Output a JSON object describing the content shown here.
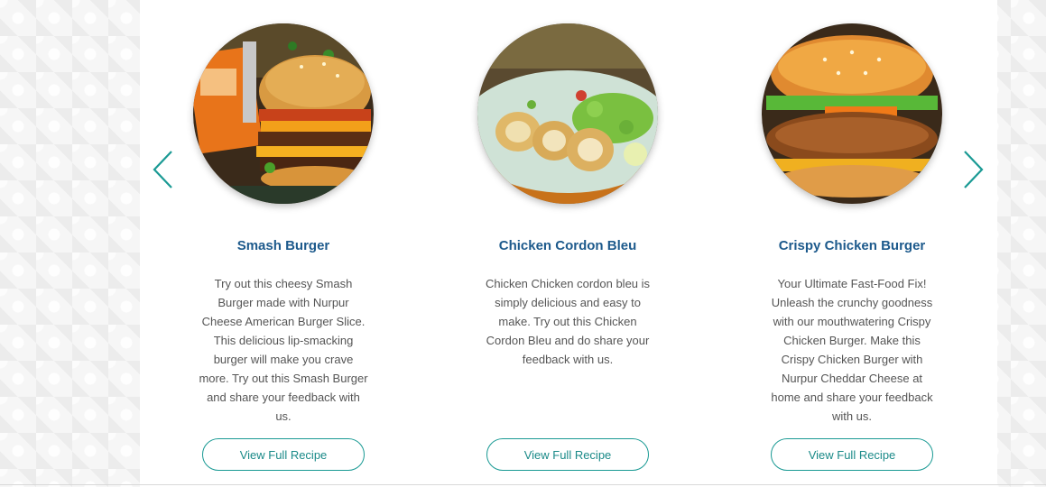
{
  "carousel": {
    "prev_icon": "chevron-left-icon",
    "next_icon": "chevron-right-icon",
    "accent_color": "#1a9a94",
    "title_color": "#1d5a8c",
    "cards": [
      {
        "title": "Smash Burger",
        "description": "Try out this cheesy Smash Burger made with Nurpur Cheese American Burger Slice. This delicious lip-smacking burger will make you crave more. Try out this Smash Burger and share your feedback with us.",
        "button_label": "View Full Recipe",
        "image": "smash-burger-photo"
      },
      {
        "title": "Chicken Cordon Bleu",
        "description": "Chicken Chicken cordon bleu is simply delicious and easy to make. Try out this Chicken Cordon Bleu and do share your feedback with us.",
        "button_label": "View Full Recipe",
        "image": "chicken-cordon-bleu-photo"
      },
      {
        "title": "Crispy Chicken Burger",
        "description": "Your Ultimate Fast-Food Fix! Unleash the crunchy goodness with our mouthwatering Crispy Chicken Burger. Make this Crispy Chicken Burger with Nurpur Cheddar Cheese at home and share your feedback with us.",
        "button_label": "View Full Recipe",
        "image": "crispy-chicken-burger-photo"
      }
    ]
  }
}
